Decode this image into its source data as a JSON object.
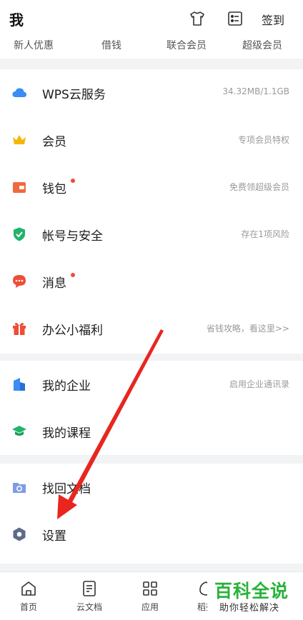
{
  "header": {
    "title": "我",
    "checkin_label": "签到"
  },
  "quick_links": [
    "新人优惠",
    "借钱",
    "联合会员",
    "超级会员"
  ],
  "section1": [
    {
      "label": "WPS云服务",
      "sub": "34.32MB/1.1GB"
    },
    {
      "label": "会员",
      "sub": "专项会员特权"
    },
    {
      "label": "钱包",
      "sub": "免费领超级会员"
    },
    {
      "label": "帐号与安全",
      "sub": "存在1项风险"
    },
    {
      "label": "消息",
      "sub": ""
    },
    {
      "label": "办公小福利",
      "sub": "省钱攻略，看这里>>"
    }
  ],
  "section2": [
    {
      "label": "我的企业",
      "sub": "启用企业通讯录"
    },
    {
      "label": "我的课程",
      "sub": ""
    }
  ],
  "section3": [
    {
      "label": "找回文档"
    },
    {
      "label": "设置"
    }
  ],
  "tabs": [
    {
      "label": "首页"
    },
    {
      "label": "云文档"
    },
    {
      "label": "应用"
    },
    {
      "label": "稻壳"
    }
  ],
  "watermark": {
    "title": "百科全说",
    "subtitle": "助你轻松解决"
  },
  "colors": {
    "accent_blue": "#3b8cf5",
    "badge_red": "#ef4d36",
    "watermark_green": "#27b23a",
    "arrow_red": "#e8261f"
  }
}
